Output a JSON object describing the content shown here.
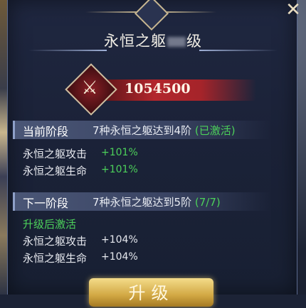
{
  "title": {
    "prefix": "永恒之躯",
    "suffix": "级"
  },
  "power": {
    "value": "1054500"
  },
  "current_stage": {
    "label": "当前阶段",
    "description": "7种永恒之躯达到4阶",
    "status": "(已激活)",
    "stats": [
      {
        "name": "永恒之躯攻击",
        "value": "+101%"
      },
      {
        "name": "永恒之躯生命",
        "value": "+101%"
      }
    ]
  },
  "next_stage": {
    "label": "下一阶段",
    "description": "7种永恒之躯达到5阶",
    "progress": "(7/7)",
    "note": "升级后激活",
    "stats": [
      {
        "name": "永恒之躯攻击",
        "value": "+104%"
      },
      {
        "name": "永恒之躯生命",
        "value": "+104%"
      }
    ]
  },
  "upgrade_button": {
    "label": "升级"
  },
  "colors": {
    "accent_green": "#4cd05a",
    "power_red": "#b2262c",
    "button_gold": "#d2a844"
  },
  "icons": [
    "close-icon",
    "sword-emblem-icon",
    "diamond-ornament-icon"
  ]
}
